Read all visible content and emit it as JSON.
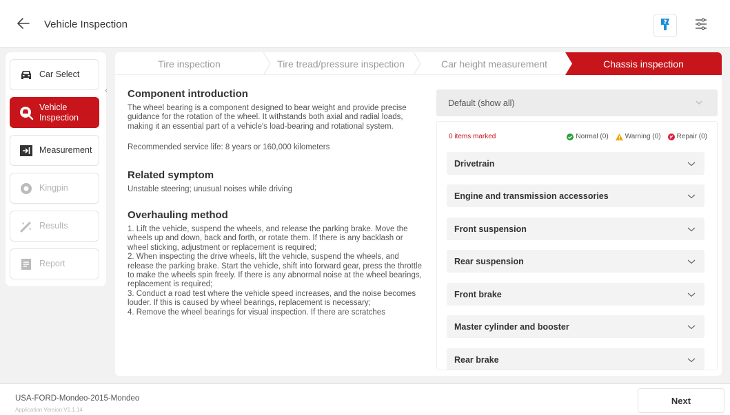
{
  "header": {
    "title": "Vehicle Inspection"
  },
  "sidebar": {
    "items": [
      {
        "label": "Car Select",
        "icon": "car-icon",
        "state": "normal"
      },
      {
        "label": "Vehicle Inspection",
        "icon": "inspection-icon",
        "state": "active"
      },
      {
        "label": "Measurement",
        "icon": "measurement-icon",
        "state": "normal"
      },
      {
        "label": "Kingpin",
        "icon": "kingpin-icon",
        "state": "disabled"
      },
      {
        "label": "Results",
        "icon": "results-icon",
        "state": "disabled"
      },
      {
        "label": "Report",
        "icon": "report-icon",
        "state": "disabled"
      }
    ]
  },
  "steps": [
    {
      "label": "Tire inspection"
    },
    {
      "label": "Tire tread/pressure inspection"
    },
    {
      "label": "Car height measurement"
    },
    {
      "label": "Chassis inspection",
      "active": true
    }
  ],
  "content": {
    "intro_title": "Component introduction",
    "intro_text": "The wheel bearing is a component designed to bear weight and provide precise guidance for the rotation of the wheel. It withstands both axial and radial loads, making it an essential part of a vehicle's load-bearing and rotational system.",
    "service_life": "Recommended service life: 8 years or 160,000 kilometers",
    "symptom_title": "Related symptom",
    "symptom_text": "Unstable steering; unusual noises while driving",
    "method_title": "Overhauling method",
    "method_1": "1. Lift the vehicle, suspend the wheels, and release the parking brake. Move the wheels up and down, back and forth, or rotate them. If there is any backlash or wheel sticking, adjustment or replacement is required;",
    "method_2": "2. When inspecting the drive wheels, lift the vehicle, suspend the wheels, and release the parking brake. Start the vehicle, shift into forward gear, press the throttle to make the wheels spin freely. If there is any abnormal noise at the wheel bearings, replacement is required;",
    "method_3": "3. Conduct a road test where the vehicle speed increases, and the noise becomes louder. If this is caused by wheel bearings, replacement is necessary;",
    "method_4": "4. Remove the wheel bearings for visual inspection. If there are scratches"
  },
  "filter": {
    "selected": "Default (show all)"
  },
  "summary": {
    "marked": "0 items marked",
    "normal": "Normal (0)",
    "warning": "Warning (0)",
    "repair": "Repair (0)"
  },
  "categories": [
    "Drivetrain",
    "Engine and transmission accessories",
    "Front suspension",
    "Rear suspension",
    "Front brake",
    "Master cylinder and booster",
    "Rear brake"
  ],
  "footer": {
    "vehicle": "USA-FORD-Mondeo-2015-Mondeo",
    "version": "Application Version:V1.1.14",
    "next_label": "Next"
  },
  "colors": {
    "accent": "#c8151b",
    "normal": "#2e9e3a",
    "warning": "#f0a500",
    "repair": "#d9213a",
    "help": "#1a8fd8"
  }
}
